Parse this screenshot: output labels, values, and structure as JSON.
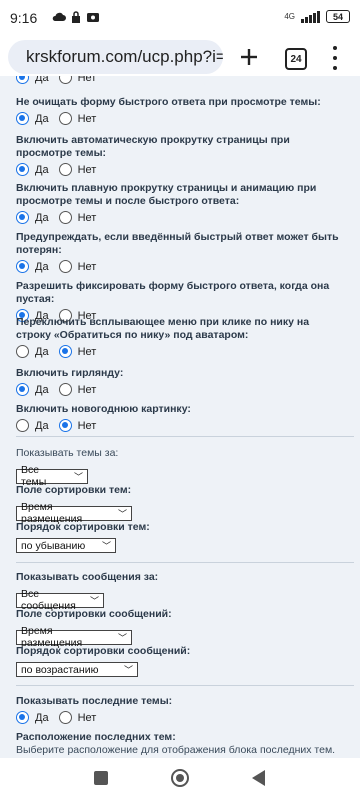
{
  "status": {
    "time": "9:16",
    "network": "4G",
    "battery": "54"
  },
  "browser": {
    "url": "krskforum.com/ucp.php?i=",
    "tab_count": "24"
  },
  "radio": {
    "yes": "Да",
    "no": "Нет"
  },
  "settings": [
    {
      "label": "Не очищать форму быстрого ответа при просмотре темы:",
      "selected": "yes"
    },
    {
      "label": "Включить автоматическую прокрутку страницы при просмотре темы:",
      "selected": "yes"
    },
    {
      "label": "Включить плавную прокрутку страницы и анимацию при просмотре темы и после быстрого ответа:",
      "selected": "yes"
    },
    {
      "label": "Предупреждать, если введённый быстрый ответ может быть потерян:",
      "selected": "yes"
    },
    {
      "label": "Разрешить фиксировать форму быстрого ответа, когда она пустая:",
      "selected": "yes"
    },
    {
      "label": "Переключить всплывающее меню при клике по нику на строку «Обратиться по нику» под аватаром:",
      "selected": "no"
    },
    {
      "label": "Включить гирлянду:",
      "selected": "yes"
    },
    {
      "label": "Включить новогоднюю картинку:",
      "selected": "no"
    }
  ],
  "selects": [
    {
      "label": "Показывать темы за:",
      "value": "Все темы"
    },
    {
      "label": "Поле сортировки тем:",
      "value": "Время размещения"
    },
    {
      "label": "Порядок сортировки тем:",
      "value": "по убыванию"
    },
    {
      "label": "Показывать сообщения за:",
      "value": "Все сообщения"
    },
    {
      "label": "Поле сортировки сообщений:",
      "value": "Время размещения"
    },
    {
      "label": "Порядок сортировки сообщений:",
      "value": "по возрастанию"
    }
  ],
  "latest": {
    "label": "Показывать последние темы:",
    "selected": "yes",
    "location_label": "Расположение последних тем:",
    "location_desc": "Выберите расположение для отображения блока последних тем."
  }
}
